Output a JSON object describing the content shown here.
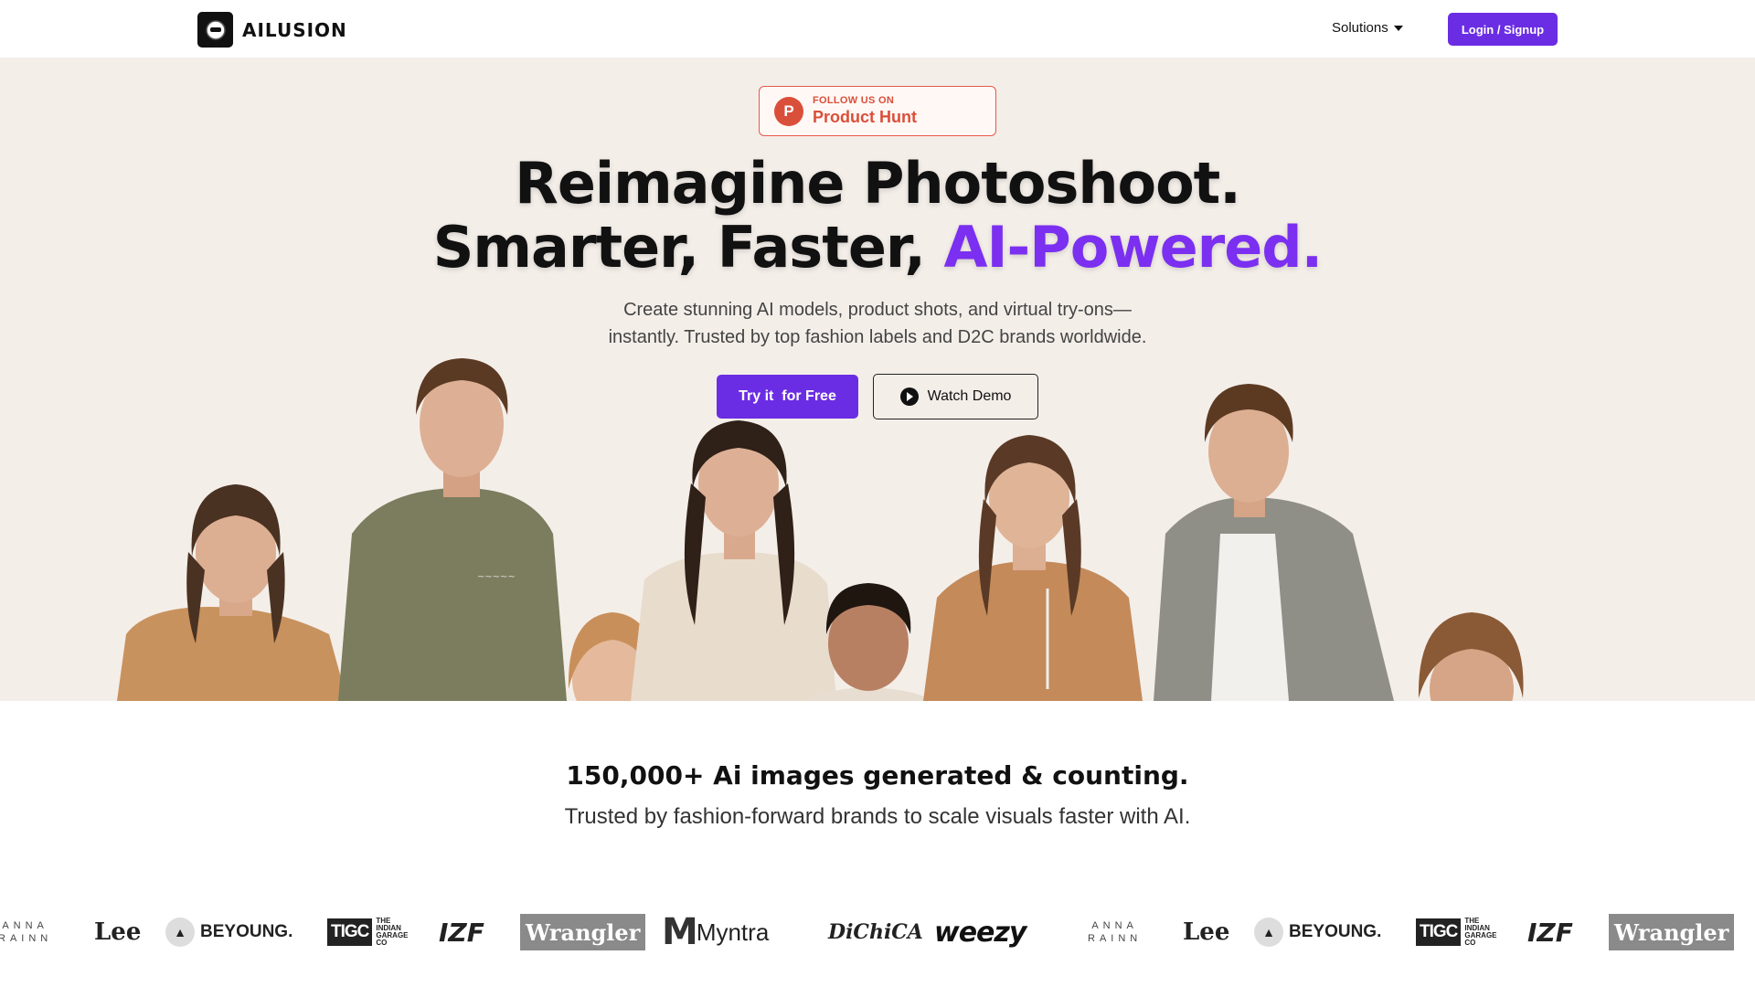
{
  "nav": {
    "brand": "AILUSION",
    "solutions_label": "Solutions",
    "login_label": "Login / Signup"
  },
  "hero": {
    "badge_small": "FOLLOW US ON",
    "badge_big": "Product Hunt",
    "badge_icon": "P",
    "headline_line1": "Reimagine Photoshoot.",
    "headline_line2_plain": "Smarter, Faster, ",
    "headline_line2_accent": "AI-Powered.",
    "subtext_line1": "Create stunning AI models, product shots, and virtual try-ons—",
    "subtext_line2": "instantly. Trusted by top fashion labels and D2C brands worldwide.",
    "try_label": "Try it  for Free",
    "demo_label": "Watch Demo",
    "accent_color": "#7b2ff0",
    "button_color": "#6b2de3"
  },
  "stats": {
    "title": "150,000+ Ai images generated & counting.",
    "subtitle": "Trusted by fashion-forward brands to scale visuals faster with AI."
  },
  "brands": {
    "anna_top": "ANNA",
    "anna_bottom": "RAINN",
    "lee": "Lee",
    "beyoung": "BEYOUNG.",
    "tigc": "TIGC",
    "tigc_side": "THE INDIAN GARAGE CO",
    "izf": "IZF",
    "wrangler": "Wrangler",
    "myntra": "Myntra",
    "dichica": "DiChiCA",
    "weezy": "weezy"
  }
}
